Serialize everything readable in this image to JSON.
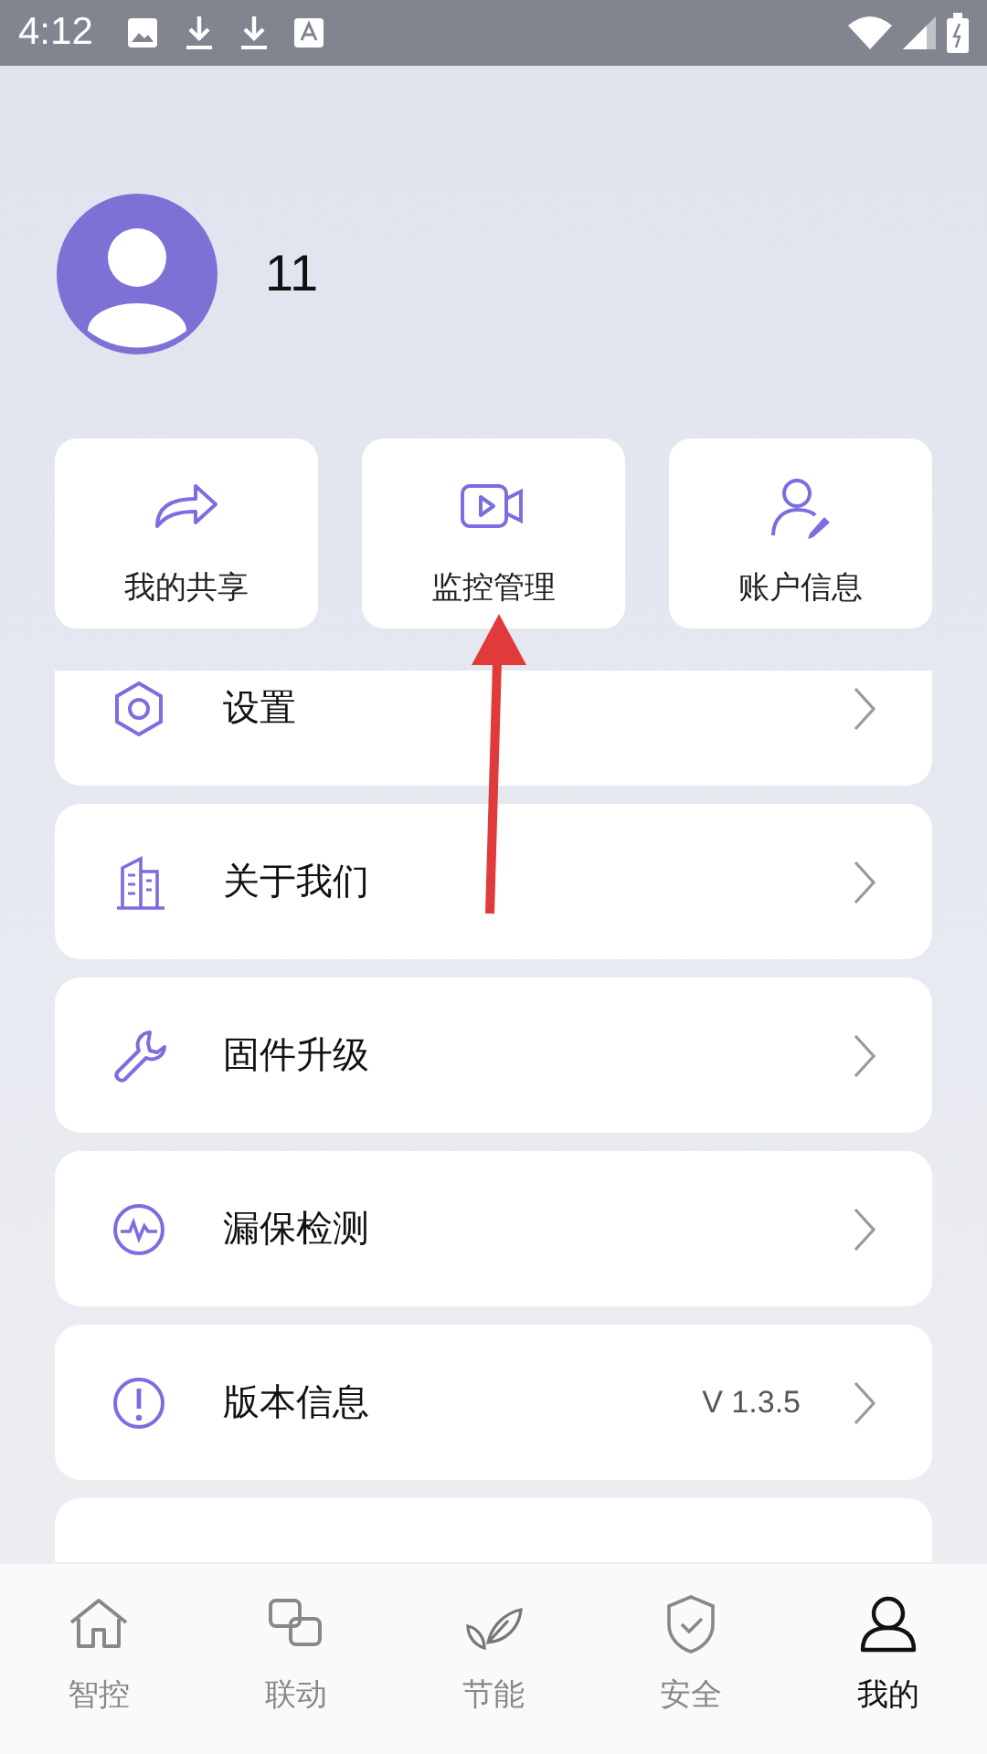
{
  "status_bar": {
    "time": "4:12"
  },
  "profile": {
    "name": "11"
  },
  "shortcuts": [
    {
      "label": "我的共享"
    },
    {
      "label": "监控管理"
    },
    {
      "label": "账户信息"
    }
  ],
  "menu": [
    {
      "label": "设置"
    },
    {
      "label": "关于我们"
    },
    {
      "label": "固件升级"
    },
    {
      "label": "漏保检测"
    },
    {
      "label": "版本信息",
      "value": "V 1.3.5"
    }
  ],
  "tabs": [
    {
      "label": "智控",
      "selected": false
    },
    {
      "label": "联动",
      "selected": false
    },
    {
      "label": "节能",
      "selected": false
    },
    {
      "label": "安全",
      "selected": false
    },
    {
      "label": "我的",
      "selected": true
    }
  ]
}
